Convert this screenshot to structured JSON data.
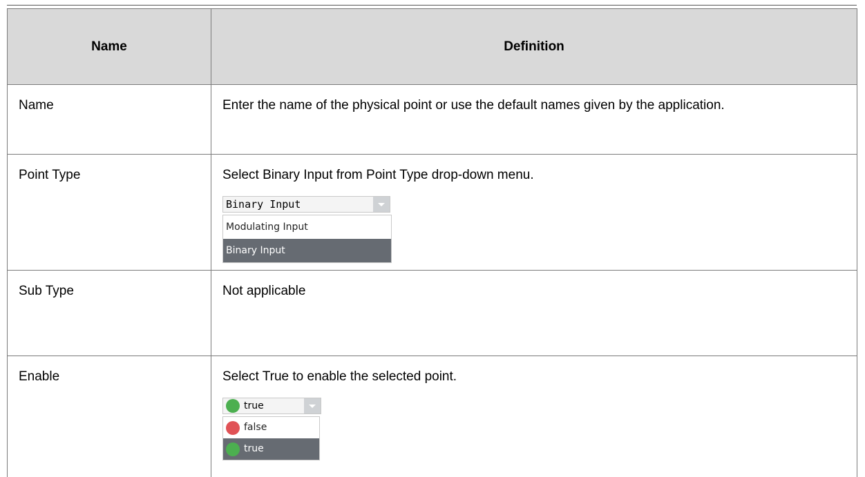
{
  "table": {
    "headers": [
      "Name",
      "Definition"
    ],
    "rows": [
      {
        "name": "Name",
        "definition": "Enter the name of the physical point or use the default names given by the application."
      },
      {
        "name": "Point Type",
        "definition": "Select Binary Input from Point Type drop-down menu."
      },
      {
        "name": "Sub Type",
        "definition": "Not applicable"
      },
      {
        "name": "Enable",
        "definition": "Select True to enable the selected point."
      }
    ]
  },
  "point_type_combo": {
    "value": "Binary Input",
    "options": [
      "Modulating Input",
      "Binary Input"
    ],
    "selected_index": 1
  },
  "enable_combo": {
    "value": "true",
    "options": [
      {
        "label": "false",
        "icon": "red-status-icon",
        "color": "#e05256"
      },
      {
        "label": "true",
        "icon": "green-status-icon",
        "color": "#4caf50"
      }
    ],
    "selected_index": 1
  }
}
